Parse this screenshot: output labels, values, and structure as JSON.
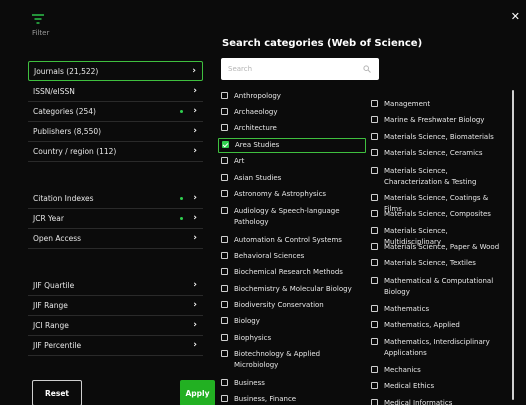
{
  "filter": {
    "label": "Filter"
  },
  "sidebar": {
    "items": [
      {
        "label": "Journals (21,522)",
        "active": true,
        "dot": false
      },
      {
        "label": "ISSN/eISSN",
        "active": false,
        "dot": false
      },
      {
        "label": "Categories (254)",
        "active": false,
        "dot": true
      },
      {
        "label": "Publishers (8,550)",
        "active": false,
        "dot": false
      },
      {
        "label": "Country / region (112)",
        "active": false,
        "dot": false
      },
      {
        "label": "Citation Indexes",
        "active": false,
        "dot": true
      },
      {
        "label": "JCR Year",
        "active": false,
        "dot": true
      },
      {
        "label": "Open Access",
        "active": false,
        "dot": false
      },
      {
        "label": "JIF Quartile",
        "active": false,
        "dot": false
      },
      {
        "label": "JIF Range",
        "active": false,
        "dot": false
      },
      {
        "label": "JCI Range",
        "active": false,
        "dot": false
      },
      {
        "label": "JIF Percentile",
        "active": false,
        "dot": false
      }
    ],
    "reset_label": "Reset",
    "apply_label": "Apply"
  },
  "panel": {
    "title": "Search categories (Web of Science)",
    "search_placeholder": "Search",
    "left_categories": [
      {
        "label": "Anthropology",
        "checked": false
      },
      {
        "label": "Archaeology",
        "checked": false
      },
      {
        "label": "Architecture",
        "checked": false
      },
      {
        "label": "Area Studies",
        "checked": true
      },
      {
        "label": "Art",
        "checked": false
      },
      {
        "label": "Asian Studies",
        "checked": false
      },
      {
        "label": "Astronomy & Astrophysics",
        "checked": false
      },
      {
        "label": "Audiology & Speech-language Pathology",
        "checked": false
      },
      {
        "label": "Automation & Control Systems",
        "checked": false
      },
      {
        "label": "Behavioral Sciences",
        "checked": false
      },
      {
        "label": "Biochemical Research Methods",
        "checked": false
      },
      {
        "label": "Biochemistry & Molecular Biology",
        "checked": false
      },
      {
        "label": "Biodiversity Conservation",
        "checked": false
      },
      {
        "label": "Biology",
        "checked": false
      },
      {
        "label": "Biophysics",
        "checked": false
      },
      {
        "label": "Biotechnology & Applied Microbiology",
        "checked": false
      },
      {
        "label": "Business",
        "checked": false
      },
      {
        "label": "Business, Finance",
        "checked": false
      }
    ],
    "right_categories": [
      {
        "label": "Management",
        "checked": false
      },
      {
        "label": "Marine & Freshwater Biology",
        "checked": false
      },
      {
        "label": "Materials Science, Biomaterials",
        "checked": false
      },
      {
        "label": "Materials Science, Ceramics",
        "checked": false
      },
      {
        "label": "Materials Science, Characterization & Testing",
        "checked": false
      },
      {
        "label": "Materials Science, Coatings & Films",
        "checked": false
      },
      {
        "label": "Materials Science, Composites",
        "checked": false
      },
      {
        "label": "Materials Science, Multidisciplinary",
        "checked": false
      },
      {
        "label": "Materials Science, Paper & Wood",
        "checked": false
      },
      {
        "label": "Materials Science, Textiles",
        "checked": false
      },
      {
        "label": "Mathematical & Computational Biology",
        "checked": false
      },
      {
        "label": "Mathematics",
        "checked": false
      },
      {
        "label": "Mathematics, Applied",
        "checked": false
      },
      {
        "label": "Mathematics, Interdisciplinary Applications",
        "checked": false
      },
      {
        "label": "Mechanics",
        "checked": false
      },
      {
        "label": "Medical Ethics",
        "checked": false
      },
      {
        "label": "Medical Informatics",
        "checked": false
      }
    ]
  },
  "colors": {
    "accent": "#2fcf4f",
    "background": "#0b0b0b",
    "apply": "#22b022"
  },
  "icons": {
    "filter": "filter-icon",
    "search": "search-icon",
    "close": "close-icon",
    "chevron": "chevron-right-icon"
  }
}
